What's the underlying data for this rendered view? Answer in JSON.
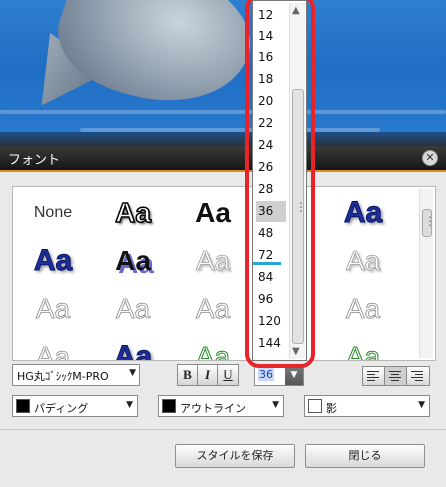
{
  "dialog": {
    "title": "フォント",
    "close_icon": "close-icon"
  },
  "styles": {
    "none_label": "None",
    "sample": "Aa"
  },
  "controls": {
    "font_name": "HG丸ｺﾞｼｯｸM-PRO",
    "bold": "B",
    "italic": "I",
    "underline": "U",
    "font_size": "36",
    "padding_label": "パディング",
    "outline_label": "アウトライン",
    "shadow_label": "影",
    "padding_color": "#000000",
    "outline_color": "#000000",
    "shadow_color": "#ffffff"
  },
  "size_list": {
    "items": [
      "12",
      "14",
      "16",
      "18",
      "20",
      "22",
      "24",
      "26",
      "28",
      "36",
      "48",
      "72",
      "84",
      "96",
      "120",
      "144"
    ],
    "selected": "36"
  },
  "buttons": {
    "save_style": "スタイルを保存",
    "close": "閉じる"
  },
  "colors": {
    "annotation_red": "#e8242a",
    "title_accent": "#e08a1e"
  }
}
